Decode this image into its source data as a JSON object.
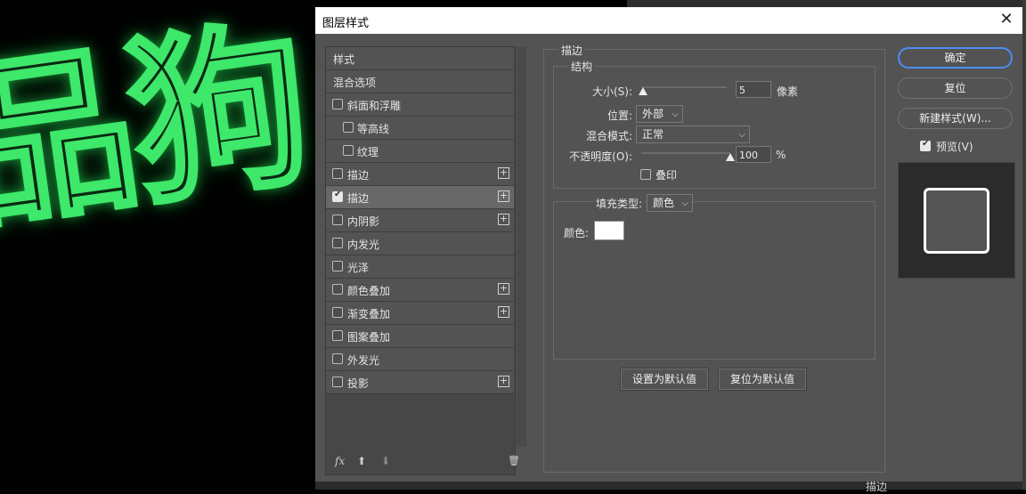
{
  "canvas": {
    "text": "品狗",
    "glow_color": "#3ee86a"
  },
  "statusbar": {
    "layer_effect_label": "描边"
  },
  "dialog": {
    "title": "图层样式",
    "close_glyph": "✕",
    "style_list": [
      {
        "label": "样式",
        "checkbox": false,
        "indent": false,
        "plus": false,
        "checked": false,
        "selected": false
      },
      {
        "label": "混合选项",
        "checkbox": false,
        "indent": false,
        "plus": false,
        "checked": false,
        "selected": false
      },
      {
        "label": "斜面和浮雕",
        "checkbox": true,
        "indent": false,
        "plus": false,
        "checked": false,
        "selected": false
      },
      {
        "label": "等高线",
        "checkbox": true,
        "indent": true,
        "plus": false,
        "checked": false,
        "selected": false
      },
      {
        "label": "纹理",
        "checkbox": true,
        "indent": true,
        "plus": false,
        "checked": false,
        "selected": false
      },
      {
        "label": "描边",
        "checkbox": true,
        "indent": false,
        "plus": true,
        "checked": false,
        "selected": false
      },
      {
        "label": "描边",
        "checkbox": true,
        "indent": false,
        "plus": true,
        "checked": true,
        "selected": true
      },
      {
        "label": "内阴影",
        "checkbox": true,
        "indent": false,
        "plus": true,
        "checked": false,
        "selected": false
      },
      {
        "label": "内发光",
        "checkbox": true,
        "indent": false,
        "plus": false,
        "checked": false,
        "selected": false
      },
      {
        "label": "光泽",
        "checkbox": true,
        "indent": false,
        "plus": false,
        "checked": false,
        "selected": false
      },
      {
        "label": "颜色叠加",
        "checkbox": true,
        "indent": false,
        "plus": true,
        "checked": false,
        "selected": false
      },
      {
        "label": "渐变叠加",
        "checkbox": true,
        "indent": false,
        "plus": true,
        "checked": false,
        "selected": false
      },
      {
        "label": "图案叠加",
        "checkbox": true,
        "indent": false,
        "plus": false,
        "checked": false,
        "selected": false
      },
      {
        "label": "外发光",
        "checkbox": true,
        "indent": false,
        "plus": false,
        "checked": false,
        "selected": false
      },
      {
        "label": "投影",
        "checkbox": true,
        "indent": false,
        "plus": true,
        "checked": false,
        "selected": false
      }
    ],
    "list_footer": {
      "fx": "fx",
      "up": "⬆",
      "down": "⬇",
      "trash": "🗑"
    },
    "stroke": {
      "section_title": "描边",
      "structure_title": "结构",
      "size_label": "大小(S):",
      "size_value": "5",
      "size_fraction": 0.02,
      "size_unit": "像素",
      "position_label": "位置:",
      "position_value": "外部",
      "blend_label": "混合模式:",
      "blend_value": "正常",
      "opacity_label": "不透明度(O):",
      "opacity_value": "100",
      "opacity_fraction": 1.0,
      "opacity_unit": "%",
      "overprint_label": "叠印",
      "fill_type_label": "填充类型:",
      "fill_type_value": "颜色",
      "color_label": "颜色:",
      "color_value": "#ffffff",
      "set_default": "设置为默认值",
      "reset_default": "复位为默认值"
    },
    "buttons": {
      "ok": "确定",
      "reset": "复位",
      "new_style": "新建样式(W)...",
      "preview": "预览(V)"
    }
  }
}
